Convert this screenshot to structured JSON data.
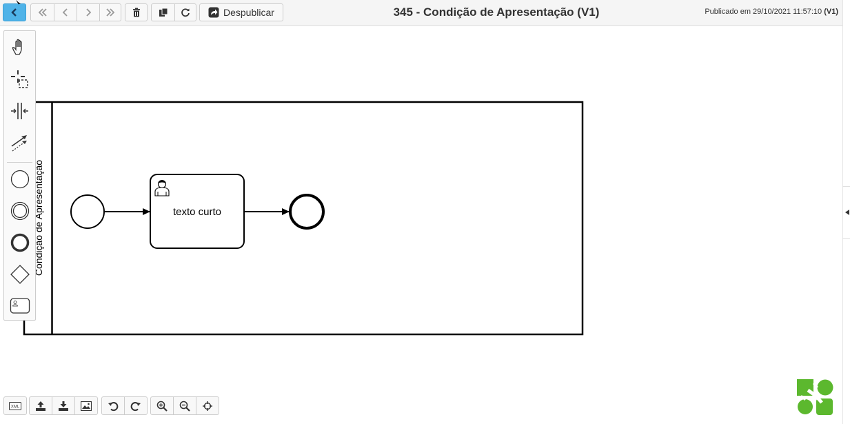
{
  "toolbar": {
    "unpublish_label": "Despublicar",
    "title": "345 - Condição de Apresentação (V1)",
    "published_prefix": "Publicado em 29/10/2021 11:57:10",
    "published_version": "(V1)"
  },
  "icons": {
    "back": "chevron-left-icon",
    "first": "double-chevron-left-icon",
    "prev": "chevron-left-icon",
    "next": "chevron-right-icon",
    "last": "double-chevron-right-icon",
    "delete": "trash-icon",
    "copy": "copy-icon",
    "refresh": "refresh-icon",
    "unpublish": "share-icon"
  },
  "palette": {
    "items": [
      "hand-tool-icon",
      "lasso-tool-icon",
      "space-tool-icon",
      "connect-tool-icon",
      "start-event-icon",
      "intermediate-event-icon",
      "end-event-icon",
      "gateway-icon",
      "user-task-icon"
    ]
  },
  "diagram": {
    "pool_label": "Condição de Apresentação",
    "task_label": "texto curto"
  },
  "bottom_toolbar": {
    "xml_label": "XML",
    "items": [
      "xml-icon",
      "upload-icon",
      "download-icon",
      "image-icon",
      "undo-icon",
      "redo-icon",
      "zoom-in-icon",
      "zoom-out-icon",
      "center-icon"
    ]
  },
  "colors": {
    "accent": "#4fb3e8",
    "logo": "#5cb82e",
    "stroke": "#000000"
  }
}
